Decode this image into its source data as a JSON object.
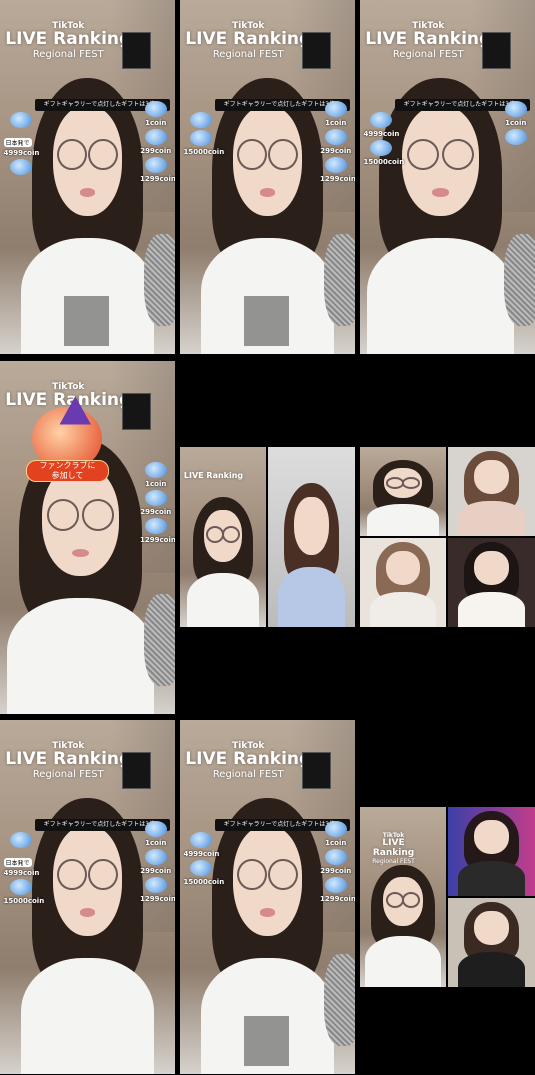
{
  "overlay": {
    "brand": "TikTok",
    "ranking_title": "LIVE Ranking",
    "ranking_subtitle": "Regional FEST",
    "gift_banner": "ギフトギャラリーで点灯したギフトは3倍pt",
    "left_label": "日本発で",
    "coins": {
      "c1": "1coin",
      "c4999": "4999coin",
      "c299": "299coin",
      "c15000": "15000coin",
      "c1299": "1299coin"
    },
    "fan_club_button": "ファンクラブに\n参加して"
  },
  "colors": {
    "background": "#000000",
    "banner": "#111111",
    "fan_button": "#e2421f"
  }
}
